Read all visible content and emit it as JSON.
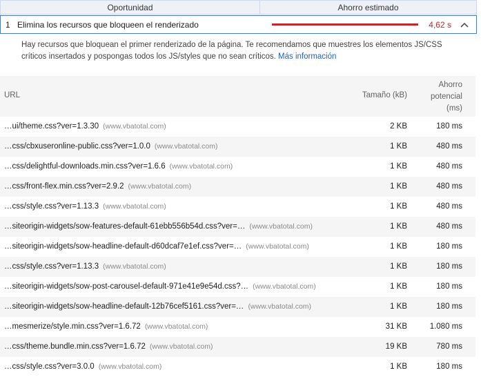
{
  "header": {
    "opportunity": "Oportunidad",
    "savings": "Ahorro estimado"
  },
  "opportunity": {
    "index": "1",
    "title": "Elimina los recursos que bloqueen el renderizado",
    "value": "4,62 s",
    "bar_color": "#c1272d"
  },
  "description": {
    "text": "Hay recursos que bloquean el primer renderizado de la página. Te recomendamos que muestres los elementos JS/CSS críticos insertados y pospongas todos los JS/styles que no sean críticos.",
    "link": "Más información"
  },
  "table": {
    "col_url": "URL",
    "col_size": "Tamaño (kB)",
    "col_savings_1": "Ahorro",
    "col_savings_2": "potencial",
    "col_savings_3": "(ms)",
    "rows": [
      {
        "url": "…ui/theme.css?ver=1.3.30",
        "host": "(www.vbatotal.com)",
        "size": "2 KB",
        "savings": "180 ms"
      },
      {
        "url": "…css/cbxuseronline-public.css?ver=1.0.0",
        "host": "(www.vbatotal.com)",
        "size": "1 KB",
        "savings": "480 ms"
      },
      {
        "url": "…css/delightful-downloads.min.css?ver=1.6.6",
        "host": "(www.vbatotal.com)",
        "size": "1 KB",
        "savings": "480 ms"
      },
      {
        "url": "…css/front-flex.min.css?ver=2.9.2",
        "host": "(www.vbatotal.com)",
        "size": "1 KB",
        "savings": "480 ms"
      },
      {
        "url": "…css/style.css?ver=1.13.3",
        "host": "(www.vbatotal.com)",
        "size": "1 KB",
        "savings": "480 ms"
      },
      {
        "url": "…siteorigin-widgets/sow-features-default-61ebb556b54d.css?ver=…",
        "host": "(www.vbatotal.com)",
        "size": "1 KB",
        "savings": "480 ms"
      },
      {
        "url": "…siteorigin-widgets/sow-headline-default-d60dcaf7e1ef.css?ver=…",
        "host": "(www.vbatotal.com)",
        "size": "1 KB",
        "savings": "180 ms"
      },
      {
        "url": "…css/style.css?ver=1.13.3",
        "host": "(www.vbatotal.com)",
        "size": "1 KB",
        "savings": "180 ms"
      },
      {
        "url": "…siteorigin-widgets/sow-post-carousel-default-971e41e9e54d.css?…",
        "host": "(www.vbatotal.com)",
        "size": "1 KB",
        "savings": "180 ms"
      },
      {
        "url": "…siteorigin-widgets/sow-headline-default-12b76cef5161.css?ver=…",
        "host": "(www.vbatotal.com)",
        "size": "1 KB",
        "savings": "180 ms"
      },
      {
        "url": "…mesmerize/style.min.css?ver=1.6.72",
        "host": "(www.vbatotal.com)",
        "size": "31 KB",
        "savings": "1.080 ms"
      },
      {
        "url": "…css/theme.bundle.min.css?ver=1.6.72",
        "host": "(www.vbatotal.com)",
        "size": "19 KB",
        "savings": "780 ms"
      },
      {
        "url": "…css/style.css?ver=3.0.0",
        "host": "(www.vbatotal.com)",
        "size": "1 KB",
        "savings": "180 ms"
      }
    ]
  }
}
